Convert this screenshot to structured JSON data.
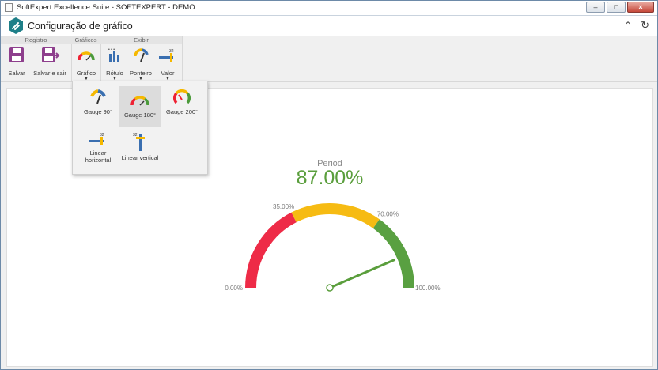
{
  "window": {
    "title": "SoftExpert Excellence Suite - SOFTEXPERT - DEMO",
    "buttons": {
      "minimize": "–",
      "maximize": "□",
      "close": "×"
    }
  },
  "header": {
    "title": "Configuração de gráfico",
    "collapse_icon": "chevron-double-up-icon",
    "refresh_icon": "refresh-icon"
  },
  "ribbon": {
    "groups": [
      {
        "label": "Registro"
      },
      {
        "label": "Gráficos"
      },
      {
        "label": "Exibir"
      }
    ],
    "buttons": {
      "save": "Salvar",
      "save_exit": "Salvar e sair",
      "chart": "Gráfico",
      "label": "Rótulo",
      "pointer": "Ponteiro",
      "value": "Valor"
    },
    "value_icon_number": "32"
  },
  "dropdown": {
    "items": [
      {
        "label": "Gauge 90°"
      },
      {
        "label": "Gauge 180°"
      },
      {
        "label": "Gauge 200°"
      },
      {
        "label": "Linear horizontal"
      },
      {
        "label": "Linear vertical"
      }
    ],
    "selected": "Gauge 180°"
  },
  "chart": {
    "title": "Period",
    "value_text": "87.00%",
    "colors": {
      "red": "#ee2b47",
      "yellow": "#f6bb13",
      "green": "#59a041",
      "value": "#5a9e3c"
    }
  },
  "chart_data": {
    "type": "gauge",
    "title": "Period",
    "value": 87.0,
    "min": 0,
    "max": 100,
    "bands": [
      {
        "from": 0,
        "to": 35,
        "color": "#ee2b47"
      },
      {
        "from": 35,
        "to": 70,
        "color": "#f6bb13"
      },
      {
        "from": 70,
        "to": 100,
        "color": "#59a041"
      }
    ],
    "tick_labels": [
      "0.00%",
      "35.00%",
      "70.00%",
      "100.00%"
    ],
    "tick_values": [
      0,
      35,
      70,
      100
    ]
  }
}
